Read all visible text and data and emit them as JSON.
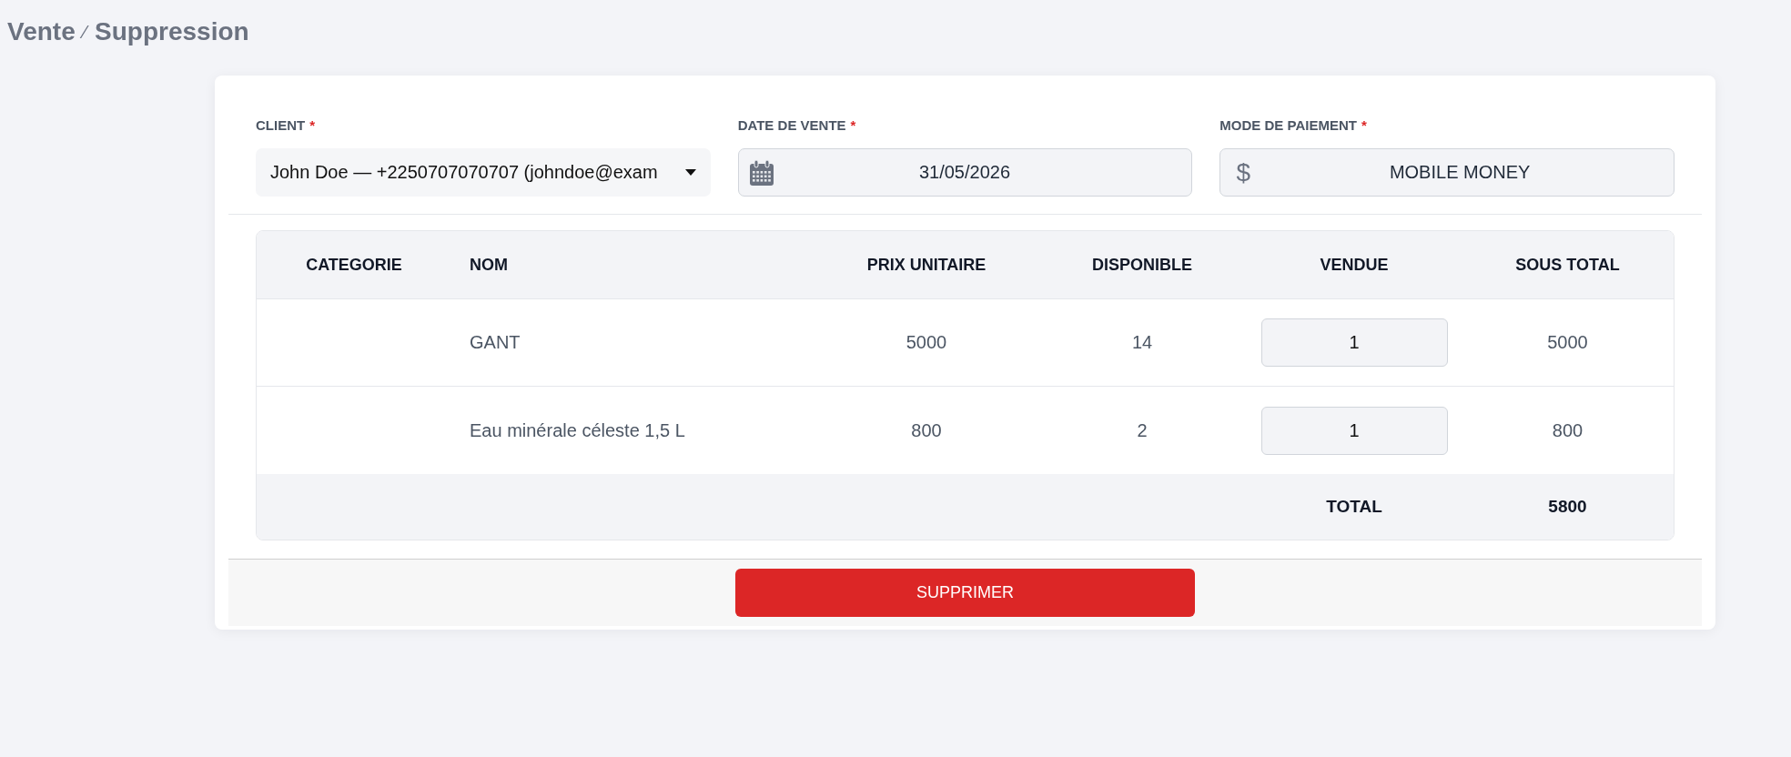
{
  "breadcrumb": {
    "items": [
      "Vente",
      "Suppression"
    ],
    "separator": "⁄"
  },
  "form": {
    "fields": [
      {
        "kind": "select",
        "label": "CLIENT",
        "required_mark": "*",
        "value": "John Doe — +2250707070707 (johndoe@exam"
      },
      {
        "kind": "date",
        "label": "DATE DE VENTE",
        "required_mark": "*",
        "value": "31/05/2026"
      },
      {
        "kind": "payment",
        "label": "MODE DE PAIEMENT",
        "required_mark": "*",
        "icon": "$",
        "value": "MOBILE MONEY"
      }
    ]
  },
  "table": {
    "columns": [
      "CATEGORIE",
      "NOM",
      "PRIX UNITAIRE",
      "DISPONIBLE",
      "VENDUE",
      "SOUS TOTAL"
    ],
    "rows": [
      {
        "name": "GANT",
        "unit_price": "5000",
        "available": "14",
        "sold": "1",
        "subtotal": "5000"
      },
      {
        "name": "Eau minérale céleste 1,5 L",
        "unit_price": "800",
        "available": "2",
        "sold": "1",
        "subtotal": "800"
      }
    ],
    "total": {
      "label": "TOTAL",
      "value": "5800"
    }
  },
  "footer": {
    "button": "SUPPRIMER"
  }
}
